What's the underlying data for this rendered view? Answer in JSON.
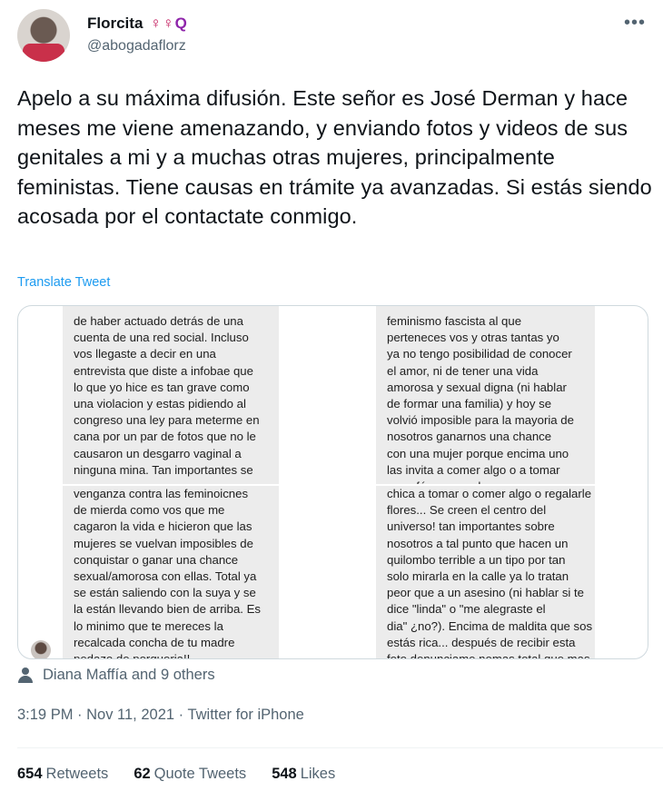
{
  "author": {
    "name": "Florcita",
    "emojis": "♀♀",
    "emoji_extra": "Q",
    "handle": "@abogadaflorz",
    "more_label": "•••"
  },
  "tweet": {
    "text": "Apelo a su máxima difusión. Este señor es José Derman y hace meses me viene amenazando, y enviando fotos y videos de sus genitales a mi y a muchas otras mujeres, principalmente feministas. Tiene causas en trámite ya avanzadas. Si estás siendo acosada por el contactate conmigo.",
    "translate_label": "Translate Tweet"
  },
  "media": {
    "left_top_lines": [
      "de haber actuado detrás de una",
      "cuenta de una red social. Incluso",
      "vos llegaste a decir en una",
      "entrevista que diste a infobae que",
      "lo que yo hice es tan grave como",
      "una violacion y estas pidiendo al",
      "congreso una ley para meterme en",
      "cana por un par de fotos que no le",
      "causaron un desgarro vaginal a",
      "ninguna mina. Tan importantes se"
    ],
    "left_bottom_lines": [
      "venganza contra las feminoicnes",
      "de mierda como vos que me",
      "cagaron la vida e hicieron que las",
      "mujeres se vuelvan imposibles de",
      "conquistar o ganar una chance",
      "sexual/amorosa con ellas. Total ya",
      "se están saliendo con la suya y se",
      "la están llevando bien de arriba. Es",
      "lo minimo que te mereces la",
      "recalcada concha de tu madre",
      "pedazo de porqueria!!"
    ],
    "right_top_lines": [
      "feminismo fascista al que",
      "perteneces vos y otras tantas yo",
      "ya no tengo posibilidad de conocer",
      "el amor, ni de tener una vida",
      "amorosa y sexual digna (ni hablar",
      "de formar una familia) y hoy se",
      "volvió imposible para la mayoria de",
      "nosotros ganarnos una chance",
      "con una mujer porque encima uno",
      "las invita a comer algo o a tomar",
      "un café y nos rechazan con asco"
    ],
    "right_bottom_lines": [
      "chica a tomar o comer algo o regalarle",
      "flores... Se creen el centro del",
      "universo! tan importantes sobre",
      "nosotros a tal punto que hacen un",
      "quilombo terrible a un tipo por tan",
      "solo mirarla en la calle ya lo tratan",
      "peor que a un asesino (ni hablar si te",
      "dice  \"linda\" o \"me alegraste el",
      "dia\" ¿no?). Encima de maldita que sos",
      "estás rica... después de recibir esta",
      "foto denunciame nomas total que mas"
    ]
  },
  "liked_by": "Diana Maffía and 9 others",
  "meta": {
    "time": "3:19 PM",
    "date": "Nov 11, 2021",
    "source": "Twitter for iPhone",
    "separator": " · "
  },
  "stats": {
    "retweets_count": "654",
    "retweets_label": "Retweets",
    "quotes_count": "62",
    "quotes_label": "Quote Tweets",
    "likes_count": "548",
    "likes_label": "Likes"
  },
  "colors": {
    "accent": "#1d9bf0",
    "secondary_text": "#536471",
    "primary_text": "#0f1419"
  }
}
